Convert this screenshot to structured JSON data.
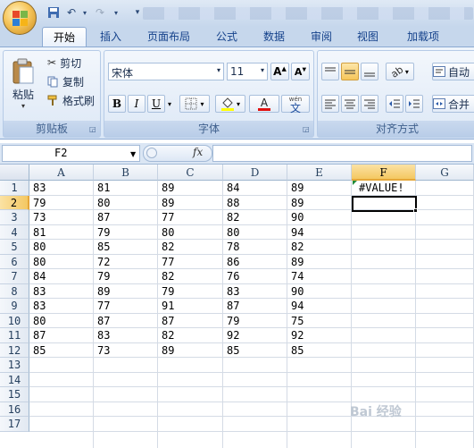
{
  "ribbon": {
    "tabs": [
      "开始",
      "插入",
      "页面布局",
      "公式",
      "数据",
      "审阅",
      "视图",
      "加载项"
    ],
    "active_tab": "开始",
    "clipboard": {
      "group_label": "剪贴板",
      "paste_label": "粘贴",
      "cut_label": "剪切",
      "copy_label": "复制",
      "format_painter_label": "格式刷"
    },
    "font": {
      "group_label": "字体",
      "font_name": "宋体",
      "font_size": "11",
      "bold": "B",
      "italic": "I",
      "underline": "U",
      "phonetic": "wén"
    },
    "alignment": {
      "group_label": "对齐方式",
      "wrap_label": "自动",
      "merge_label": "合并"
    }
  },
  "formula_bar": {
    "name_box": "F2",
    "fx_label": "fx",
    "formula": ""
  },
  "sheet": {
    "columns": [
      "A",
      "B",
      "C",
      "D",
      "E",
      "F",
      "G"
    ],
    "selected_column": "F",
    "rows": [
      "1",
      "2",
      "3",
      "4",
      "5",
      "6",
      "7",
      "8",
      "9",
      "10",
      "11",
      "12",
      "13",
      "14",
      "15",
      "16",
      "17"
    ],
    "selected_row": "2",
    "data": [
      [
        "83",
        "81",
        "89",
        "84",
        "89",
        "#VALUE!"
      ],
      [
        "79",
        "80",
        "89",
        "88",
        "89",
        ""
      ],
      [
        "73",
        "87",
        "77",
        "82",
        "90",
        ""
      ],
      [
        "81",
        "79",
        "80",
        "80",
        "94",
        ""
      ],
      [
        "80",
        "85",
        "82",
        "78",
        "82",
        ""
      ],
      [
        "80",
        "72",
        "77",
        "86",
        "89",
        ""
      ],
      [
        "84",
        "79",
        "82",
        "76",
        "74",
        ""
      ],
      [
        "83",
        "89",
        "79",
        "83",
        "90",
        ""
      ],
      [
        "83",
        "77",
        "91",
        "87",
        "94",
        ""
      ],
      [
        "80",
        "87",
        "87",
        "79",
        "75",
        ""
      ],
      [
        "87",
        "83",
        "82",
        "92",
        "92",
        ""
      ],
      [
        "85",
        "73",
        "89",
        "85",
        "85",
        ""
      ]
    ]
  },
  "watermark": "Bai 经验",
  "colors": {
    "ribbon_blue": "#c6d7ec",
    "selected_header": "#f4c862",
    "error_indicator": "#1e8a3a"
  }
}
